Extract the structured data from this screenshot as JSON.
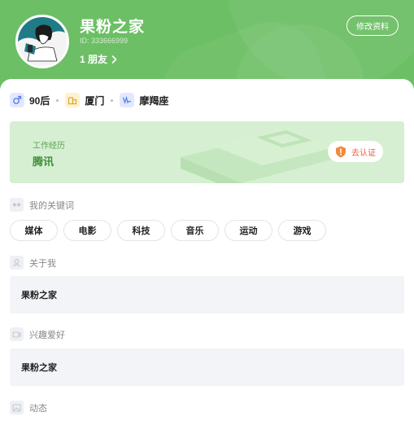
{
  "profile": {
    "name": "果粉之家",
    "id_text": "ID: 333666999",
    "friends_label": "1 朋友",
    "edit_label": "修改资料"
  },
  "info": {
    "age": "90后",
    "city": "厦门",
    "zodiac": "摩羯座"
  },
  "work": {
    "label": "工作经历",
    "company": "腾讯",
    "verify_label": "去认证"
  },
  "keywords": {
    "title": "我的关键词",
    "tags": [
      "媒体",
      "电影",
      "科技",
      "音乐",
      "运动",
      "游戏"
    ]
  },
  "about": {
    "title": "关于我",
    "content": "果粉之家"
  },
  "hobbies": {
    "title": "兴趣爱好",
    "content": "果粉之家"
  },
  "posts": {
    "title": "动态"
  },
  "colors": {
    "header_green": "#6cbf64",
    "work_bg": "#d6efd2",
    "verify_orange": "#ef5a3c",
    "male_blue": "#5b7cf0",
    "city_yellow": "#f3c445"
  }
}
